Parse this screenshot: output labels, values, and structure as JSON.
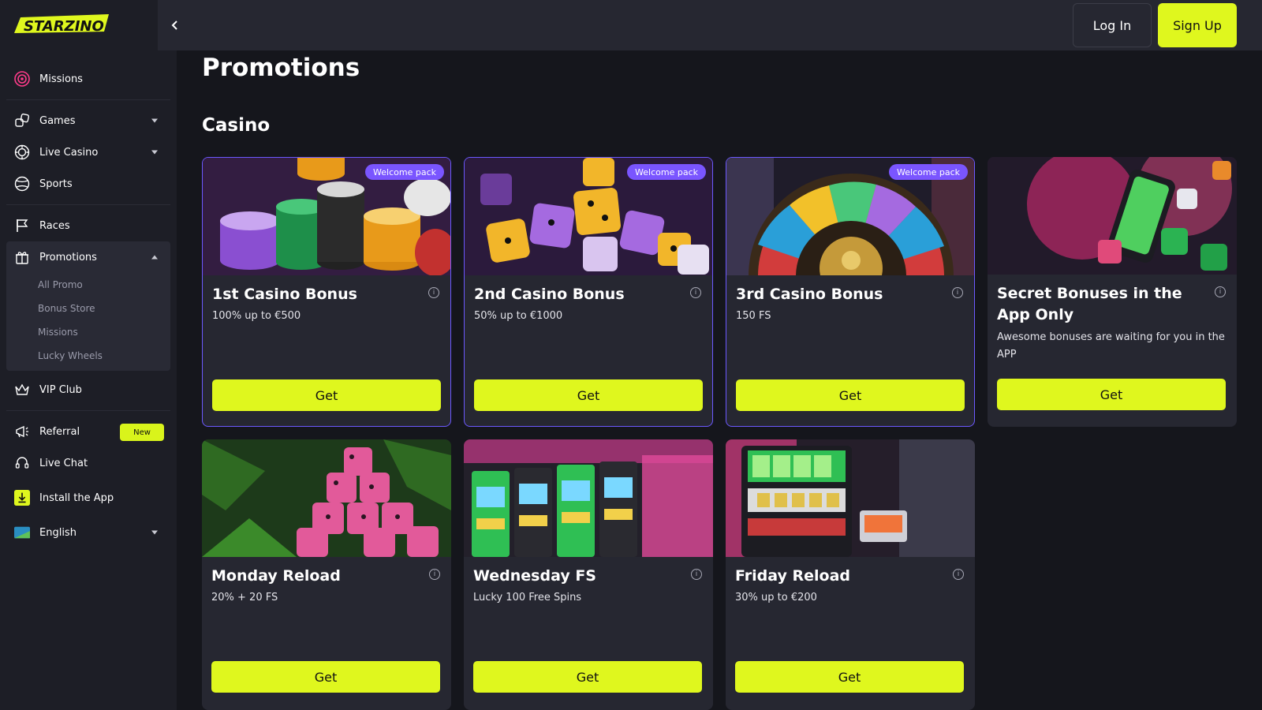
{
  "brand": {
    "logo_text": "STARZINO",
    "accent": "#dff71e",
    "badge_color": "#7a55ff"
  },
  "header": {
    "login_label": "Log In",
    "signup_label": "Sign Up"
  },
  "sidebar": {
    "missions": "Missions",
    "games": "Games",
    "live_casino": "Live Casino",
    "sports": "Sports",
    "races": "Races",
    "promotions": "Promotions",
    "promo_sub": [
      "All Promo",
      "Bonus Store",
      "Missions",
      "Lucky Wheels"
    ],
    "vip_club": "VIP Club",
    "referral": "Referral",
    "referral_badge": "New",
    "live_chat": "Live Chat",
    "install_app": "Install the App",
    "language": "English"
  },
  "main": {
    "title": "Promotions",
    "section": "Casino",
    "cards": [
      {
        "title": "1st Casino Bonus",
        "desc": "100% up to €500",
        "badge": "Welcome pack",
        "cta": "Get"
      },
      {
        "title": "2nd Casino Bonus",
        "desc": "50% up to €1000",
        "badge": "Welcome pack",
        "cta": "Get"
      },
      {
        "title": "3rd Casino Bonus",
        "desc": "150 FS",
        "badge": "Welcome pack",
        "cta": "Get"
      },
      {
        "title": "Secret Bonuses in the App Only",
        "desc": "Awesome bonuses are waiting for you in the APP",
        "cta": "Get"
      },
      {
        "title": "Monday Reload",
        "desc": "20% + 20 FS",
        "cta": "Get"
      },
      {
        "title": "Wednesday FS",
        "desc": "Lucky 100 Free Spins",
        "cta": "Get"
      },
      {
        "title": "Friday Reload",
        "desc": "30% up to €200",
        "cta": "Get"
      }
    ]
  }
}
